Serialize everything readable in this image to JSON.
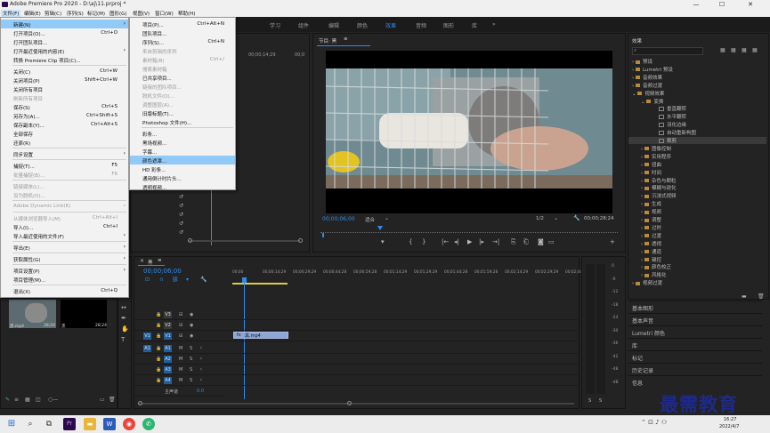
{
  "window": {
    "title": "Adobe Premiere Pro 2020 - D:\\aj\\11.prproj *",
    "minimize": "—",
    "maximize": "☐",
    "close": "✕"
  },
  "menubar": [
    "文件(F)",
    "编辑(E)",
    "剪辑(C)",
    "序列(S)",
    "标记(M)",
    "图形(G)",
    "视图(V)",
    "窗口(W)",
    "帮助(H)"
  ],
  "workspaces": {
    "items": [
      "学习",
      "组件",
      "编辑",
      "颜色",
      "效果",
      "音频",
      "图形",
      "库"
    ],
    "current": "效果",
    "overflow": "»"
  },
  "file_menu": [
    {
      "label": "新建(N)",
      "shortcut": "",
      "sub": true,
      "hl": true
    },
    {
      "label": "打开项目(O)...",
      "shortcut": "Ctrl+O"
    },
    {
      "label": "打开团队项目...",
      "shortcut": ""
    },
    {
      "label": "打开最近使用的内容(E)",
      "shortcut": "",
      "sub": true
    },
    {
      "label": "转换 Premiere Clip 项目(C)...",
      "shortcut": ""
    },
    {
      "sep": true
    },
    {
      "label": "关闭(C)",
      "shortcut": "Ctrl+W"
    },
    {
      "label": "关闭项目(P)",
      "shortcut": "Shift+Ctrl+W"
    },
    {
      "label": "关闭所有项目",
      "shortcut": ""
    },
    {
      "label": "刷新所有项目",
      "shortcut": "",
      "dis": true
    },
    {
      "label": "保存(S)",
      "shortcut": "Ctrl+S"
    },
    {
      "label": "另存为(A)...",
      "shortcut": "Ctrl+Shift+S"
    },
    {
      "label": "保存副本(Y)...",
      "shortcut": "Ctrl+Alt+S"
    },
    {
      "label": "全部保存",
      "shortcut": ""
    },
    {
      "label": "还原(R)",
      "shortcut": ""
    },
    {
      "sep": true
    },
    {
      "label": "同步设置",
      "shortcut": "",
      "sub": true
    },
    {
      "sep": true
    },
    {
      "label": "捕捉(T)...",
      "shortcut": "F5"
    },
    {
      "label": "批量捕捉(B)...",
      "shortcut": "F6",
      "dis": true
    },
    {
      "sep": true
    },
    {
      "label": "链接媒体(L)...",
      "shortcut": "",
      "dis": true
    },
    {
      "label": "设为脱机(O)...",
      "shortcut": "",
      "dis": true
    },
    {
      "sep": true
    },
    {
      "label": "Adobe Dynamic Link(K)",
      "shortcut": "",
      "sub": true,
      "dis": true
    },
    {
      "sep": true
    },
    {
      "label": "从媒体浏览器导入(M)",
      "shortcut": "Ctrl+Alt+I",
      "dis": true
    },
    {
      "label": "导入(I)...",
      "shortcut": "Ctrl+I"
    },
    {
      "label": "导入最近使用的文件(F)",
      "shortcut": "",
      "sub": true
    },
    {
      "sep": true
    },
    {
      "label": "导出(E)",
      "shortcut": "",
      "sub": true
    },
    {
      "sep": true
    },
    {
      "label": "获取属性(G)",
      "shortcut": "",
      "sub": true
    },
    {
      "sep": true
    },
    {
      "label": "项目设置(P)",
      "shortcut": "",
      "sub": true
    },
    {
      "label": "项目管理(M)...",
      "shortcut": ""
    },
    {
      "sep": true
    },
    {
      "label": "退出(X)",
      "shortcut": "Ctrl+Q"
    }
  ],
  "new_submenu": [
    {
      "label": "项目(P)...",
      "shortcut": "Ctrl+Alt+N"
    },
    {
      "label": "团队项目...",
      "shortcut": ""
    },
    {
      "label": "序列(S)...",
      "shortcut": "Ctrl+N"
    },
    {
      "label": "来自剪辑的序列",
      "shortcut": "",
      "dis": true
    },
    {
      "label": "素材箱(B)",
      "shortcut": "Ctrl+/",
      "dis": true
    },
    {
      "label": "搜索素材箱",
      "shortcut": "",
      "dis": true
    },
    {
      "label": "已共享项目...",
      "shortcut": ""
    },
    {
      "label": "链接的团队项目...",
      "shortcut": "",
      "dis": true
    },
    {
      "label": "脱机文件(O)...",
      "shortcut": "",
      "dis": true
    },
    {
      "label": "调整图层(A)...",
      "shortcut": "",
      "dis": true
    },
    {
      "label": "旧版标题(T)...",
      "shortcut": ""
    },
    {
      "label": "Photoshop 文件(H)...",
      "shortcut": ""
    },
    {
      "sep": true
    },
    {
      "label": "彩条...",
      "shortcut": ""
    },
    {
      "label": "黑场视频...",
      "shortcut": ""
    },
    {
      "label": "字幕...",
      "shortcut": ""
    },
    {
      "label": "颜色遮罩...",
      "shortcut": "",
      "hl": true
    },
    {
      "label": "HD 彩条...",
      "shortcut": ""
    },
    {
      "label": "通用倒计时片头...",
      "shortcut": ""
    },
    {
      "label": "透明视频...",
      "shortcut": ""
    }
  ],
  "program": {
    "title": "节目: 黑",
    "menu_icon": "≡",
    "timecode": "00;00;06;00",
    "fit": "适合",
    "fraction": "1/2",
    "duration": "00;00;28;24"
  },
  "source": {
    "ruler_time": "00;00;14;29",
    "ruler_time2": "00;0"
  },
  "effects": {
    "title": "效果",
    "tree": [
      {
        "label": "预设",
        "level": 0,
        "type": "folder"
      },
      {
        "label": "Lumetri 预设",
        "level": 0,
        "type": "folder"
      },
      {
        "label": "音频效果",
        "level": 0,
        "type": "folder"
      },
      {
        "label": "音频过渡",
        "level": 0,
        "type": "folder"
      },
      {
        "label": "视频效果",
        "level": 0,
        "type": "folder",
        "open": true
      },
      {
        "label": "变换",
        "level": 1,
        "type": "folder",
        "open": true
      },
      {
        "label": "垂直翻转",
        "level": 2,
        "type": "fx"
      },
      {
        "label": "水平翻转",
        "level": 2,
        "type": "fx"
      },
      {
        "label": "羽化边缘",
        "level": 2,
        "type": "fx"
      },
      {
        "label": "自动重新构图",
        "level": 2,
        "type": "fx"
      },
      {
        "label": "裁剪",
        "level": 2,
        "type": "fx",
        "sel": true
      },
      {
        "label": "图像控制",
        "level": 1,
        "type": "folder"
      },
      {
        "label": "实用程序",
        "level": 1,
        "type": "folder"
      },
      {
        "label": "扭曲",
        "level": 1,
        "type": "folder"
      },
      {
        "label": "时间",
        "level": 1,
        "type": "folder"
      },
      {
        "label": "杂色与颗粒",
        "level": 1,
        "type": "folder"
      },
      {
        "label": "模糊与锐化",
        "level": 1,
        "type": "folder"
      },
      {
        "label": "沉浸式视频",
        "level": 1,
        "type": "folder"
      },
      {
        "label": "生成",
        "level": 1,
        "type": "folder"
      },
      {
        "label": "视频",
        "level": 1,
        "type": "folder"
      },
      {
        "label": "调整",
        "level": 1,
        "type": "folder"
      },
      {
        "label": "过时",
        "level": 1,
        "type": "folder"
      },
      {
        "label": "过渡",
        "level": 1,
        "type": "folder"
      },
      {
        "label": "透视",
        "level": 1,
        "type": "folder"
      },
      {
        "label": "通道",
        "level": 1,
        "type": "folder"
      },
      {
        "label": "键控",
        "level": 1,
        "type": "folder"
      },
      {
        "label": "颜色校正",
        "level": 1,
        "type": "folder"
      },
      {
        "label": "风格化",
        "level": 1,
        "type": "folder"
      },
      {
        "label": "视频过渡",
        "level": 0,
        "type": "folder"
      }
    ],
    "sections": [
      "基本图形",
      "基本声音",
      "Lumetri 颜色",
      "库",
      "标记",
      "历史记录",
      "信息"
    ]
  },
  "timeline": {
    "title": "黑",
    "menu_icon": "≡",
    "close": "×",
    "timecode": "00;00;06;00",
    "ruler": [
      "00;00",
      "00;00;14;29",
      "00;00;29;29",
      "00;00;44;28",
      "00;00;59;28",
      "00;01;14;29",
      "00;01;29;29",
      "00;01;44;28",
      "00;01;59;28",
      "00;02;14;29",
      "00;02;29;29",
      "00;02;44"
    ],
    "video_tracks": [
      "V3",
      "V2",
      "V1"
    ],
    "audio_tracks": [
      "A1",
      "A2",
      "A3",
      "A4"
    ],
    "source_v": "V1",
    "source_a": "A1",
    "master": "主声道",
    "master_val": "0.0",
    "clip_label": "黑.mp4",
    "m_label": "M",
    "s_label": "S"
  },
  "project": {
    "clip1_name": "黑.mp4",
    "clip1_dur": "28;24",
    "clip2_name": "黑",
    "clip2_dur": "28;24"
  },
  "meter": {
    "scale": [
      "0",
      "-6",
      "-12",
      "-18",
      "-24",
      "-30",
      "-36",
      "-42",
      "-48",
      "-dB"
    ],
    "labels": [
      "S",
      "S"
    ]
  },
  "taskbar": {
    "time": "16:27",
    "date": "2022/4/7"
  },
  "watermark": "最需教育",
  "colors": {
    "accent": "#2d8ceb",
    "menu_highlight": "#91c9f7",
    "clip": "#8ea5d6",
    "playhead": "#2d8ceb"
  }
}
